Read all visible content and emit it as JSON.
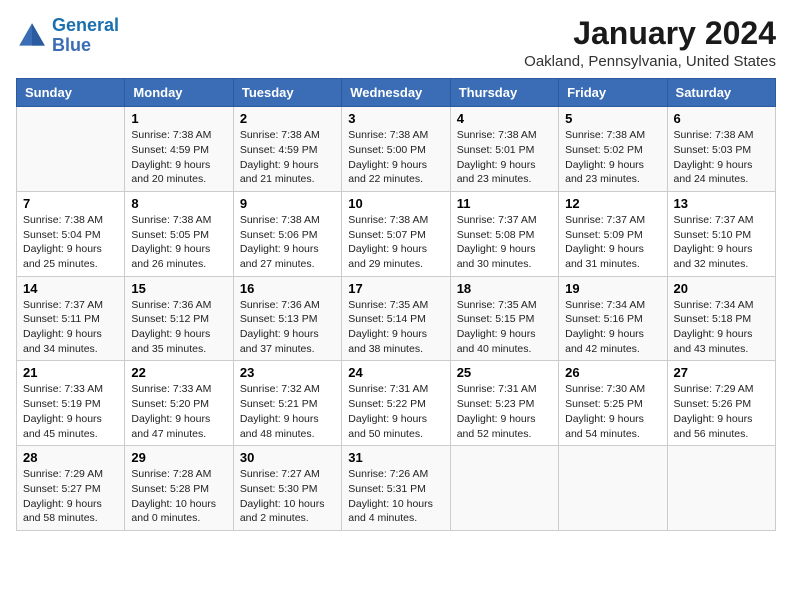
{
  "header": {
    "logo_line1": "General",
    "logo_line2": "Blue",
    "month": "January 2024",
    "location": "Oakland, Pennsylvania, United States"
  },
  "days_of_week": [
    "Sunday",
    "Monday",
    "Tuesday",
    "Wednesday",
    "Thursday",
    "Friday",
    "Saturday"
  ],
  "weeks": [
    [
      {
        "day": "",
        "sunrise": "",
        "sunset": "",
        "daylight": ""
      },
      {
        "day": "1",
        "sunrise": "Sunrise: 7:38 AM",
        "sunset": "Sunset: 4:59 PM",
        "daylight": "Daylight: 9 hours and 20 minutes."
      },
      {
        "day": "2",
        "sunrise": "Sunrise: 7:38 AM",
        "sunset": "Sunset: 4:59 PM",
        "daylight": "Daylight: 9 hours and 21 minutes."
      },
      {
        "day": "3",
        "sunrise": "Sunrise: 7:38 AM",
        "sunset": "Sunset: 5:00 PM",
        "daylight": "Daylight: 9 hours and 22 minutes."
      },
      {
        "day": "4",
        "sunrise": "Sunrise: 7:38 AM",
        "sunset": "Sunset: 5:01 PM",
        "daylight": "Daylight: 9 hours and 23 minutes."
      },
      {
        "day": "5",
        "sunrise": "Sunrise: 7:38 AM",
        "sunset": "Sunset: 5:02 PM",
        "daylight": "Daylight: 9 hours and 23 minutes."
      },
      {
        "day": "6",
        "sunrise": "Sunrise: 7:38 AM",
        "sunset": "Sunset: 5:03 PM",
        "daylight": "Daylight: 9 hours and 24 minutes."
      }
    ],
    [
      {
        "day": "7",
        "sunrise": "Sunrise: 7:38 AM",
        "sunset": "Sunset: 5:04 PM",
        "daylight": "Daylight: 9 hours and 25 minutes."
      },
      {
        "day": "8",
        "sunrise": "Sunrise: 7:38 AM",
        "sunset": "Sunset: 5:05 PM",
        "daylight": "Daylight: 9 hours and 26 minutes."
      },
      {
        "day": "9",
        "sunrise": "Sunrise: 7:38 AM",
        "sunset": "Sunset: 5:06 PM",
        "daylight": "Daylight: 9 hours and 27 minutes."
      },
      {
        "day": "10",
        "sunrise": "Sunrise: 7:38 AM",
        "sunset": "Sunset: 5:07 PM",
        "daylight": "Daylight: 9 hours and 29 minutes."
      },
      {
        "day": "11",
        "sunrise": "Sunrise: 7:37 AM",
        "sunset": "Sunset: 5:08 PM",
        "daylight": "Daylight: 9 hours and 30 minutes."
      },
      {
        "day": "12",
        "sunrise": "Sunrise: 7:37 AM",
        "sunset": "Sunset: 5:09 PM",
        "daylight": "Daylight: 9 hours and 31 minutes."
      },
      {
        "day": "13",
        "sunrise": "Sunrise: 7:37 AM",
        "sunset": "Sunset: 5:10 PM",
        "daylight": "Daylight: 9 hours and 32 minutes."
      }
    ],
    [
      {
        "day": "14",
        "sunrise": "Sunrise: 7:37 AM",
        "sunset": "Sunset: 5:11 PM",
        "daylight": "Daylight: 9 hours and 34 minutes."
      },
      {
        "day": "15",
        "sunrise": "Sunrise: 7:36 AM",
        "sunset": "Sunset: 5:12 PM",
        "daylight": "Daylight: 9 hours and 35 minutes."
      },
      {
        "day": "16",
        "sunrise": "Sunrise: 7:36 AM",
        "sunset": "Sunset: 5:13 PM",
        "daylight": "Daylight: 9 hours and 37 minutes."
      },
      {
        "day": "17",
        "sunrise": "Sunrise: 7:35 AM",
        "sunset": "Sunset: 5:14 PM",
        "daylight": "Daylight: 9 hours and 38 minutes."
      },
      {
        "day": "18",
        "sunrise": "Sunrise: 7:35 AM",
        "sunset": "Sunset: 5:15 PM",
        "daylight": "Daylight: 9 hours and 40 minutes."
      },
      {
        "day": "19",
        "sunrise": "Sunrise: 7:34 AM",
        "sunset": "Sunset: 5:16 PM",
        "daylight": "Daylight: 9 hours and 42 minutes."
      },
      {
        "day": "20",
        "sunrise": "Sunrise: 7:34 AM",
        "sunset": "Sunset: 5:18 PM",
        "daylight": "Daylight: 9 hours and 43 minutes."
      }
    ],
    [
      {
        "day": "21",
        "sunrise": "Sunrise: 7:33 AM",
        "sunset": "Sunset: 5:19 PM",
        "daylight": "Daylight: 9 hours and 45 minutes."
      },
      {
        "day": "22",
        "sunrise": "Sunrise: 7:33 AM",
        "sunset": "Sunset: 5:20 PM",
        "daylight": "Daylight: 9 hours and 47 minutes."
      },
      {
        "day": "23",
        "sunrise": "Sunrise: 7:32 AM",
        "sunset": "Sunset: 5:21 PM",
        "daylight": "Daylight: 9 hours and 48 minutes."
      },
      {
        "day": "24",
        "sunrise": "Sunrise: 7:31 AM",
        "sunset": "Sunset: 5:22 PM",
        "daylight": "Daylight: 9 hours and 50 minutes."
      },
      {
        "day": "25",
        "sunrise": "Sunrise: 7:31 AM",
        "sunset": "Sunset: 5:23 PM",
        "daylight": "Daylight: 9 hours and 52 minutes."
      },
      {
        "day": "26",
        "sunrise": "Sunrise: 7:30 AM",
        "sunset": "Sunset: 5:25 PM",
        "daylight": "Daylight: 9 hours and 54 minutes."
      },
      {
        "day": "27",
        "sunrise": "Sunrise: 7:29 AM",
        "sunset": "Sunset: 5:26 PM",
        "daylight": "Daylight: 9 hours and 56 minutes."
      }
    ],
    [
      {
        "day": "28",
        "sunrise": "Sunrise: 7:29 AM",
        "sunset": "Sunset: 5:27 PM",
        "daylight": "Daylight: 9 hours and 58 minutes."
      },
      {
        "day": "29",
        "sunrise": "Sunrise: 7:28 AM",
        "sunset": "Sunset: 5:28 PM",
        "daylight": "Daylight: 10 hours and 0 minutes."
      },
      {
        "day": "30",
        "sunrise": "Sunrise: 7:27 AM",
        "sunset": "Sunset: 5:30 PM",
        "daylight": "Daylight: 10 hours and 2 minutes."
      },
      {
        "day": "31",
        "sunrise": "Sunrise: 7:26 AM",
        "sunset": "Sunset: 5:31 PM",
        "daylight": "Daylight: 10 hours and 4 minutes."
      },
      {
        "day": "",
        "sunrise": "",
        "sunset": "",
        "daylight": ""
      },
      {
        "day": "",
        "sunrise": "",
        "sunset": "",
        "daylight": ""
      },
      {
        "day": "",
        "sunrise": "",
        "sunset": "",
        "daylight": ""
      }
    ]
  ]
}
